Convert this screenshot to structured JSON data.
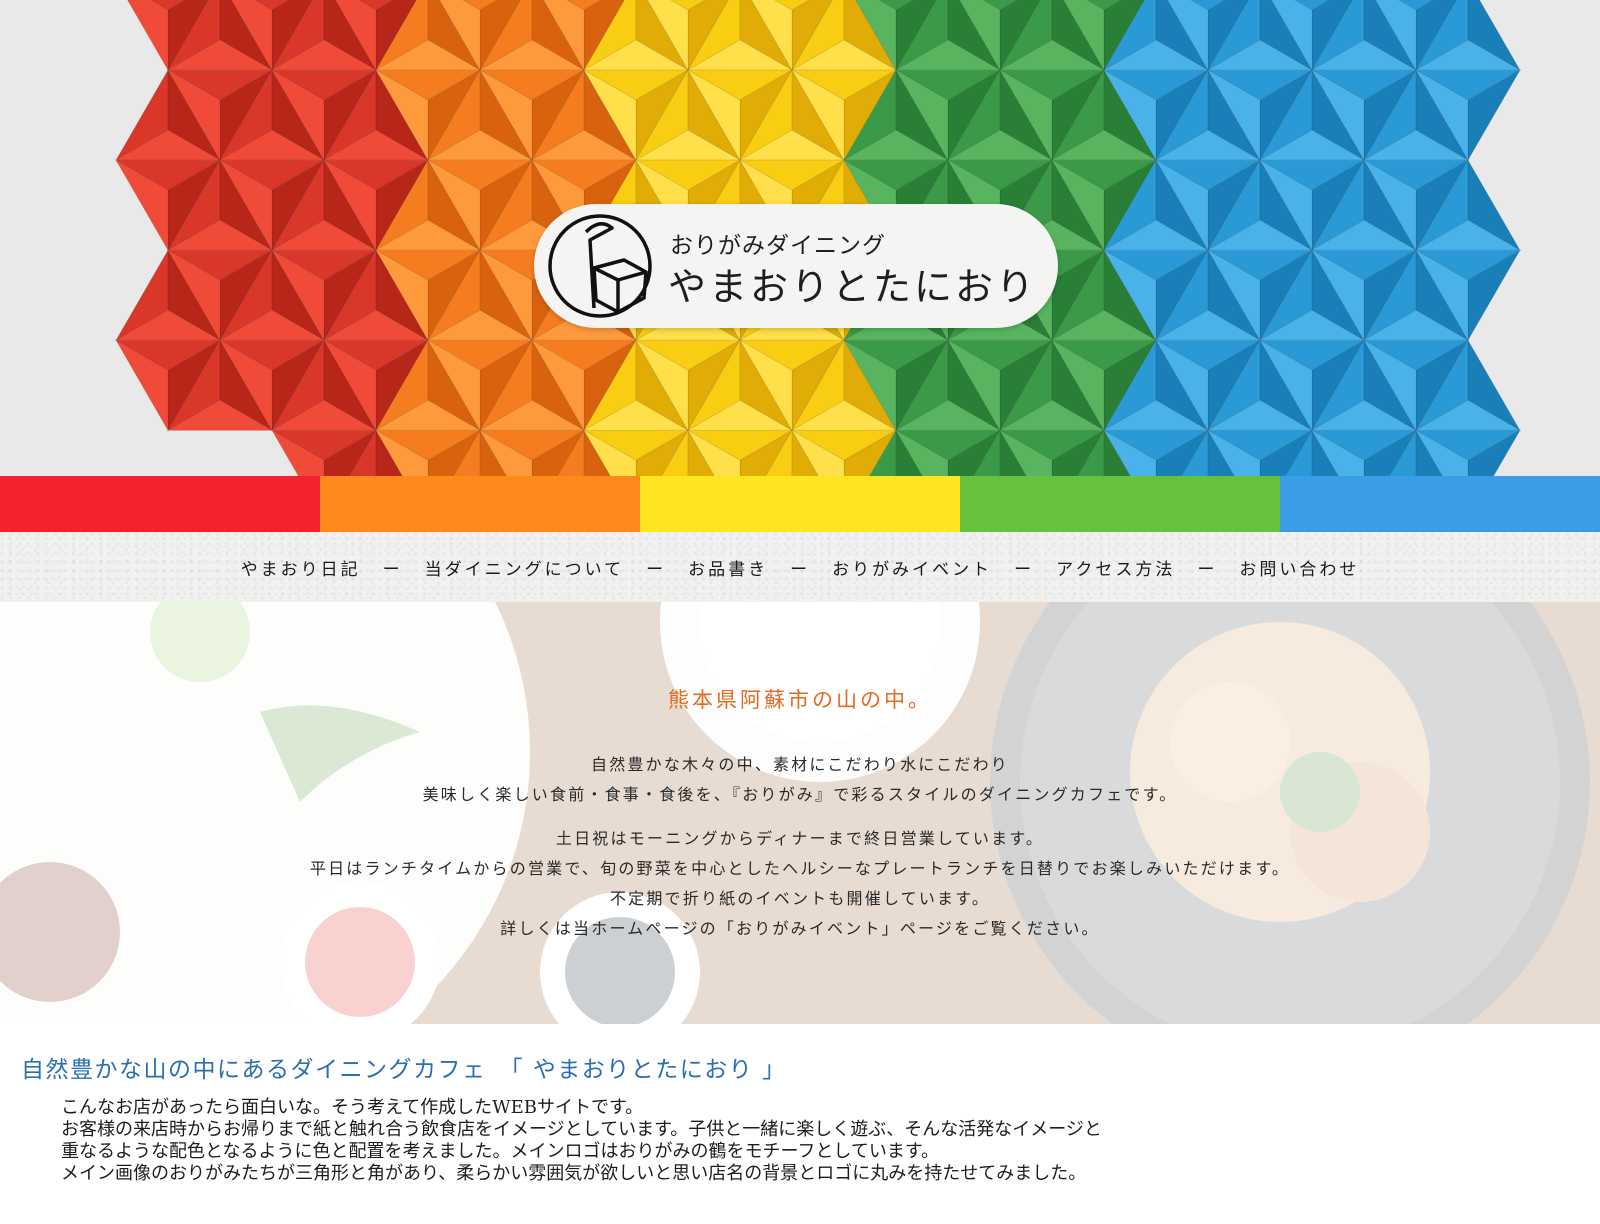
{
  "brand": {
    "subtitle": "おりがみダイニング",
    "name": "やまおりとたにおり"
  },
  "colors": {
    "rainbow": [
      "#f4222f",
      "#ff8a1c",
      "#ffe51f",
      "#66c23d",
      "#3b9de8"
    ],
    "accent_orange": "#e46a1e",
    "accent_blue": "#2b6fb3"
  },
  "nav": {
    "items": [
      {
        "label": "やまおり日記"
      },
      {
        "label": "当ダイニングについて"
      },
      {
        "label": "お品書き"
      },
      {
        "label": "おりがみイベント"
      },
      {
        "label": "アクセス方法"
      },
      {
        "label": "お問い合わせ"
      }
    ],
    "separator": "ー"
  },
  "intro": {
    "heading": "熊本県阿蘇市の山の中。",
    "paragraph1": [
      "自然豊かな木々の中、素材にこだわり水にこだわり",
      "美味しく楽しい食前・食事・食後を、『おりがみ』で彩るスタイルのダイニングカフェです。"
    ],
    "paragraph2": [
      "土日祝はモーニングからディナーまで終日営業しています。",
      "平日はランチタイムからの営業で、旬の野菜を中心としたヘルシーなプレートランチを日替りでお楽しみいただけます。",
      "不定期で折り紙のイベントも開催しています。",
      "詳しくは当ホームページの「おりがみイベント」ページをご覧ください。"
    ]
  },
  "about": {
    "title": "自然豊かな山の中にあるダイニングカフェ　「 やまおりとたにおり 」",
    "lines": [
      "こんなお店があったら面白いな。そう考えて作成したWEBサイトです。",
      "お客様の来店時からお帰りまで紙と触れ合う飲食店をイメージとしています。子供と一緒に楽しく遊ぶ、そんな活発なイメージと",
      "重なるような配色となるように色と配置を考えました。メインロゴはおりがみの鶴をモチーフとしています。",
      "メイン画像のおりがみたちが三角形と角があり、柔らかい雰囲気が欲しいと思い店名の背景とロゴに丸みを持たせてみました。"
    ]
  }
}
